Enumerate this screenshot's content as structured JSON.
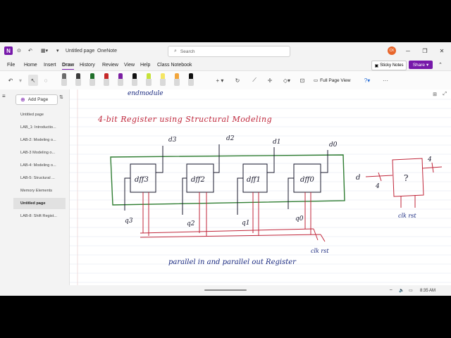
{
  "titlebar": {
    "logo_letter": "N",
    "page_title": "Untitled page",
    "app_name": "OneNote",
    "search_placeholder": "Search",
    "avatar_initials": "CK"
  },
  "menubar": {
    "items": [
      {
        "label": "File"
      },
      {
        "label": "Home"
      },
      {
        "label": "Insert"
      },
      {
        "label": "Draw",
        "active": true
      },
      {
        "label": "History"
      },
      {
        "label": "Review"
      },
      {
        "label": "View"
      },
      {
        "label": "Help"
      },
      {
        "label": "Class Notebook"
      }
    ],
    "sticky_notes": "Sticky Notes",
    "share": "Share"
  },
  "ribbon": {
    "full_page_view": "Full Page View",
    "pen_colors": [
      "#6b6b6b",
      "#3a3a3a",
      "#1f6f2a",
      "#c62828",
      "#7b1fa2",
      "#111111",
      "#c6e23a",
      "#f5e663",
      "#f2a53a",
      "#111111"
    ]
  },
  "pages": {
    "add_page": "Add Page",
    "items": [
      {
        "label": "Untitled page",
        "selected": false
      },
      {
        "label": "LAB_1: Introductio...",
        "selected": false
      },
      {
        "label": "LAB-2: Modeling o...",
        "selected": false
      },
      {
        "label": "LAB-3 Modeling o...",
        "selected": false
      },
      {
        "label": "LAB-4: Modeling o...",
        "selected": false
      },
      {
        "label": "LAB-5: Structural ...",
        "selected": false
      },
      {
        "label": "Memory Elements",
        "selected": false
      },
      {
        "label": "Untitled page",
        "selected": true
      },
      {
        "label": "LAB-8: Shift Regist...",
        "selected": false
      }
    ]
  },
  "canvas": {
    "top_fragment": "endmodule",
    "heading": "4-bit Register using Structural Modeling",
    "flipflops": [
      "dff3",
      "dff2",
      "dff1",
      "dff0"
    ],
    "inputs": [
      "d3",
      "d2",
      "d1",
      "d0"
    ],
    "outputs": [
      "q3",
      "q2",
      "q1",
      "q0"
    ],
    "clk_label": "clk rst",
    "caption": "parallel in and parallel out Register",
    "block": {
      "d": "d",
      "width_in": "4",
      "q": "?",
      "width_out": "4",
      "clk": "clk rst"
    }
  },
  "status": {
    "time": "8:35 AM"
  }
}
